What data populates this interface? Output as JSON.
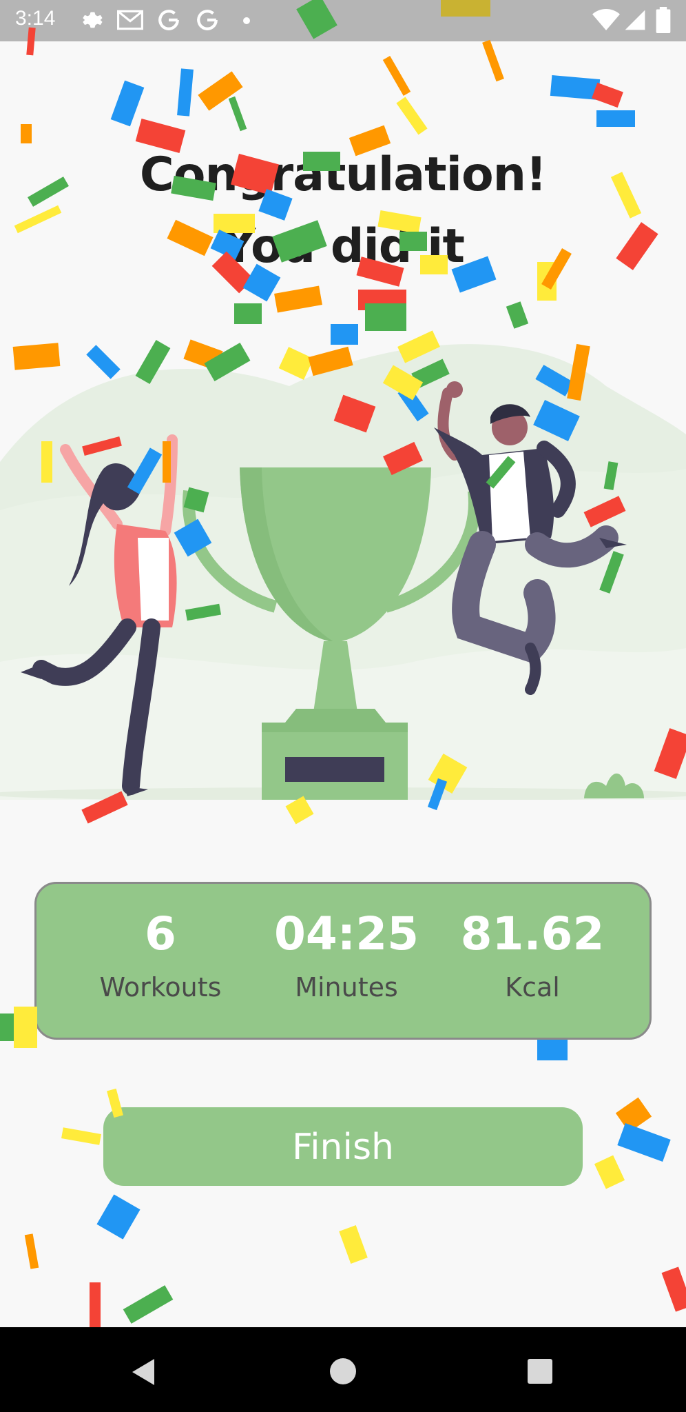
{
  "status_bar": {
    "time": "3:14",
    "icons_left": [
      "gear-icon",
      "gmail-icon",
      "google-icon",
      "google-icon",
      "dot-icon"
    ],
    "icons_right": [
      "wifi-icon",
      "signal-icon",
      "battery-icon"
    ]
  },
  "heading": {
    "line1": "Congratulation!",
    "line2": "You did it"
  },
  "stats": [
    {
      "value": "6",
      "label": "Workouts"
    },
    {
      "value": "04:25",
      "label": "Minutes"
    },
    {
      "value": "81.62",
      "label": "Kcal"
    }
  ],
  "finish_button": {
    "label": "Finish"
  },
  "colors": {
    "accent_green": "#93c789",
    "background": "#f8f8f8",
    "confetti": [
      "#f44336",
      "#2196f3",
      "#4caf50",
      "#ffeb3b",
      "#ff9800"
    ]
  },
  "nav_bar": {
    "icons": [
      "back-icon",
      "home-icon",
      "recents-icon"
    ]
  }
}
